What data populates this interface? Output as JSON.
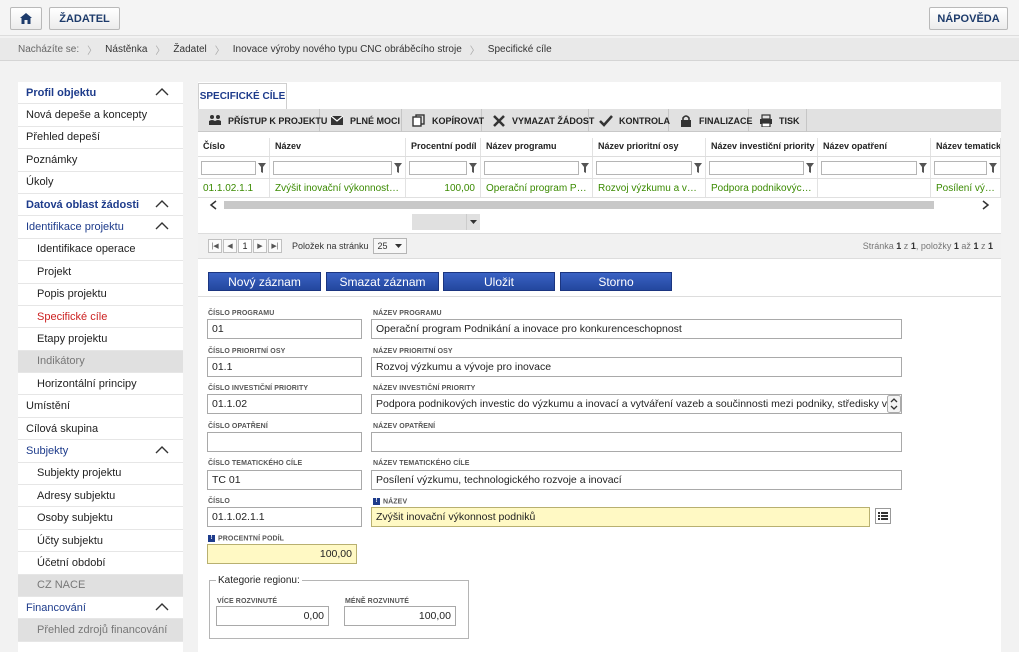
{
  "header": {
    "home_icon": "home-icon",
    "zadatel_label": "ŽADATEL",
    "help_label": "NÁPOVĚDA"
  },
  "breadcrumb": {
    "prefix": "Nacházíte se:",
    "items": [
      "Nástěnka",
      "Žadatel",
      "Inovace výroby nového typu CNC obráběcího stroje",
      "Specifické cíle"
    ]
  },
  "sidebar": {
    "items": [
      {
        "label": "Profil objektu",
        "type": "sec",
        "chev": true
      },
      {
        "label": "Nová depeše a koncepty",
        "type": "plain"
      },
      {
        "label": "Přehled depeší",
        "type": "plain"
      },
      {
        "label": "Poznámky",
        "type": "plain"
      },
      {
        "label": "Úkoly",
        "type": "plain"
      },
      {
        "label": "Datová oblast žádosti",
        "type": "sec",
        "chev": true
      },
      {
        "label": "Identifikace projektu",
        "type": "sec2",
        "chev": true
      },
      {
        "label": "Identifikace operace",
        "type": "sub"
      },
      {
        "label": "Projekt",
        "type": "sub"
      },
      {
        "label": "Popis projektu",
        "type": "sub"
      },
      {
        "label": "Specifické cíle",
        "type": "sub active"
      },
      {
        "label": "Etapy projektu",
        "type": "sub"
      },
      {
        "label": "Indikátory",
        "type": "sub dis"
      },
      {
        "label": "Horizontální principy",
        "type": "sub"
      },
      {
        "label": "Umístění",
        "type": "plain"
      },
      {
        "label": "Cílová skupina",
        "type": "plain"
      },
      {
        "label": "Subjekty",
        "type": "sec2",
        "chev": true
      },
      {
        "label": "Subjekty projektu",
        "type": "sub"
      },
      {
        "label": "Adresy subjektu",
        "type": "sub"
      },
      {
        "label": "Osoby subjektu",
        "type": "sub"
      },
      {
        "label": "Účty subjektu",
        "type": "sub"
      },
      {
        "label": "Účetní období",
        "type": "sub"
      },
      {
        "label": "CZ NACE",
        "type": "sub dis"
      },
      {
        "label": "Financování",
        "type": "sec2",
        "chev": true
      },
      {
        "label": "Přehled zdrojů financování",
        "type": "sub dis"
      }
    ]
  },
  "tab": {
    "label": "SPECIFICKÉ CÍLE"
  },
  "toolbar": [
    {
      "label": "PŘÍSTUP K PROJEKTU",
      "icon": "people-icon"
    },
    {
      "label": "PLNÉ MOCI",
      "icon": "envelope-icon"
    },
    {
      "label": "KOPÍROVAT",
      "icon": "copy-icon"
    },
    {
      "label": "VYMAZAT ŽÁDOST",
      "icon": "cross-icon"
    },
    {
      "label": "KONTROLA",
      "icon": "check-icon"
    },
    {
      "label": "FINALIZACE",
      "icon": "lock-icon"
    },
    {
      "label": "TISK",
      "icon": "printer-icon"
    }
  ],
  "grid": {
    "columns": [
      "Číslo",
      "Název",
      "Procentní podíl",
      "Název programu",
      "Název prioritní osy",
      "Název investiční priority",
      "Název opatření",
      "Název tematickéh"
    ],
    "row": [
      "01.1.02.1.1",
      "Zvýšit inovační výkonnost p...",
      "100,00",
      "Operační program Pod...",
      "Rozvoj výzkumu a výv...",
      "Podpora podnikových i...",
      "",
      "Posílení výzkum"
    ]
  },
  "pager": {
    "page": "1",
    "per_page_label": "Položek na stránku",
    "per_page_value": "25",
    "info_prefix": "Stránka",
    "info_page": "1",
    "info_of": "z",
    "info_total_pages": "1",
    "info_items": ", položky",
    "info_from": "1",
    "info_to_label": "až",
    "info_to": "1",
    "info_z2": "z",
    "info_total": "1"
  },
  "actions": {
    "new": "Nový záznam",
    "delete": "Smazat záznam",
    "save": "Uložit",
    "cancel": "Storno"
  },
  "form": {
    "cislo_programu_label": "ČÍSLO PROGRAMU",
    "cislo_programu": "01",
    "nazev_programu_label": "NÁZEV PROGRAMU",
    "nazev_programu": "Operační program Podnikání a inovace pro konkurenceschopnost",
    "cislo_osy_label": "ČÍSLO PRIORITNÍ OSY",
    "cislo_osy": "01.1",
    "nazev_osy_label": "NÁZEV PRIORITNÍ OSY",
    "nazev_osy": "Rozvoj výzkumu a vývoje pro inovace",
    "cislo_priority_label": "ČÍSLO INVESTIČNÍ PRIORITY",
    "cislo_priority": "01.1.02",
    "nazev_priority_label": "NÁZEV INVESTIČNÍ PRIORITY",
    "nazev_priority": "Podpora podnikových investic do výzkumu a inovací a vytváření vazeb a součinnosti mezi podniky, středisky výzkumu a",
    "cislo_opatreni_label": "ČÍSLO OPATŘENÍ",
    "cislo_opatreni": "",
    "nazev_opatreni_label": "NÁZEV OPATŘENÍ",
    "nazev_opatreni": "",
    "cislo_tc_label": "ČÍSLO TEMATICKÉHO CÍLE",
    "cislo_tc": "TC 01",
    "nazev_tc_label": "NÁZEV TEMATICKÉHO CÍLE",
    "nazev_tc": "Posílení výzkumu, technologického rozvoje a inovací",
    "cislo_label": "ČÍSLO",
    "cislo": "01.1.02.1.1",
    "nazev_label": "NÁZEV",
    "nazev": "Zvýšit inovační výkonnost podniků",
    "podil_label": "PROCENTNÍ PODÍL",
    "podil": "100,00",
    "kategorie_label": "Kategorie regionu:",
    "vice_label": "VÍCE ROZVINUTÉ",
    "vice": "0,00",
    "mene_label": "MÉNĚ ROZVINUTÉ",
    "mene": "100,00"
  }
}
